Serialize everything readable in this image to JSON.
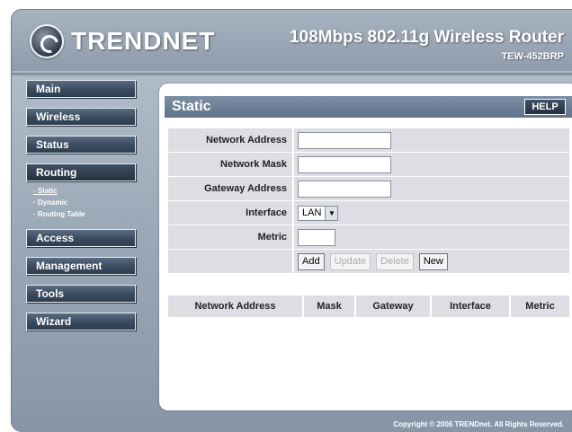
{
  "header": {
    "brand": "TRENDNET",
    "product_title": "108Mbps 802.11g Wireless Router",
    "model": "TEW-452BRP"
  },
  "sidebar": {
    "items": [
      {
        "label": "Main"
      },
      {
        "label": "Wireless"
      },
      {
        "label": "Status"
      },
      {
        "label": "Routing",
        "active": true
      },
      {
        "label": "Access"
      },
      {
        "label": "Management"
      },
      {
        "label": "Tools"
      },
      {
        "label": "Wizard"
      }
    ],
    "routing_subitems": [
      {
        "label": "Static",
        "current": true
      },
      {
        "label": "Dynamic"
      },
      {
        "label": "Routing Table"
      }
    ]
  },
  "panel": {
    "title": "Static",
    "help_label": "HELP"
  },
  "form": {
    "network_address_label": "Network Address",
    "network_address_value": "",
    "network_mask_label": "Network Mask",
    "network_mask_value": "",
    "gateway_address_label": "Gateway Address",
    "gateway_address_value": "",
    "interface_label": "Interface",
    "interface_value": "LAN",
    "metric_label": "Metric",
    "metric_value": ""
  },
  "actions": {
    "add": "Add",
    "update": "Update",
    "delete": "Delete",
    "new": "New"
  },
  "table": {
    "headers": [
      "Network Address",
      "Mask",
      "Gateway",
      "Interface",
      "Metric"
    ],
    "rows": []
  },
  "footer": {
    "copyright": "Copyright © 2006 TRENDnet. All Rights Reserved."
  },
  "colors": {
    "frame": "#9aa7b6",
    "nav_button": "#3a4a5e",
    "panel_title_bar": "#6b7f97",
    "form_cell": "#dcdee3"
  }
}
